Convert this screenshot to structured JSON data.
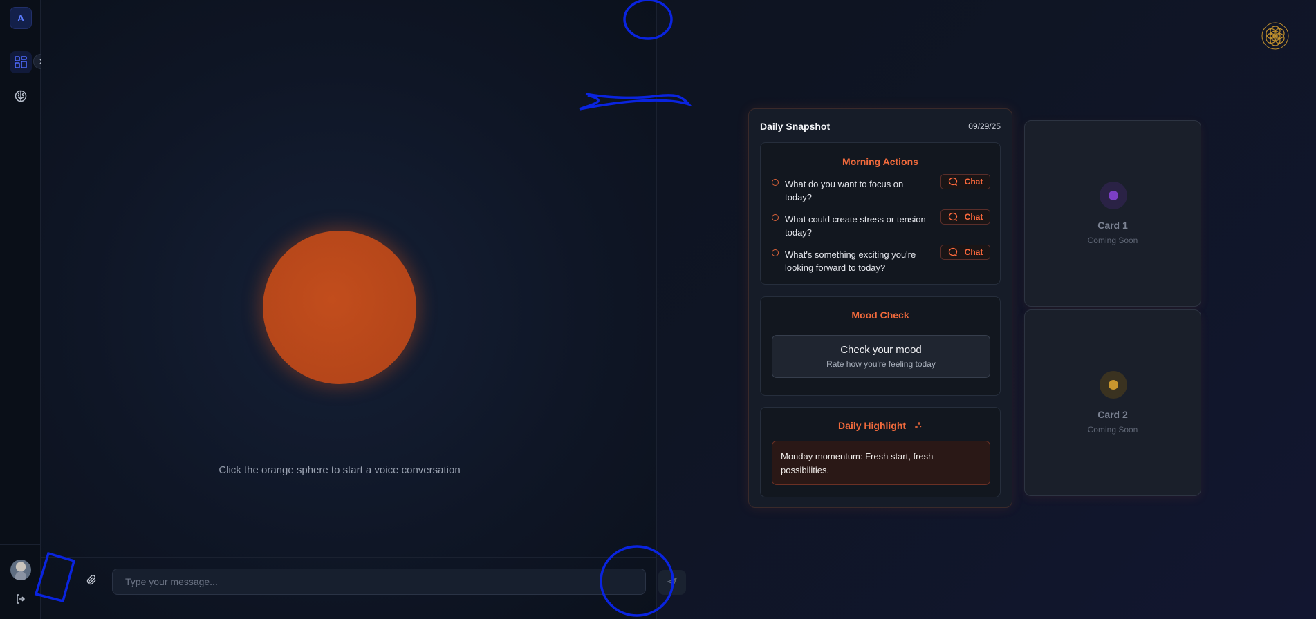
{
  "sidebar": {
    "workspace_initial": "A",
    "items": [
      {
        "icon": "dashboard-icon",
        "active": true
      },
      {
        "icon": "brain-icon",
        "active": false
      }
    ],
    "expand_icon": "chevron-right-icon",
    "logout_icon": "logout-icon"
  },
  "chat": {
    "hint": "Click the orange sphere to start a voice conversation",
    "input_placeholder": "Type your message...",
    "sphere_color": "#b5461a",
    "attach_icon": "paperclip-icon",
    "send_icon": "send-icon"
  },
  "snapshot": {
    "title": "Daily Snapshot",
    "date": "09/29/25",
    "morning_actions": {
      "title": "Morning Actions",
      "items": [
        {
          "text": "What do you want to focus on today?",
          "button": "Chat"
        },
        {
          "text": "What could create stress or tension today?",
          "button": "Chat"
        },
        {
          "text": "What's something exciting you're looking forward to today?",
          "button": "Chat"
        }
      ]
    },
    "mood_check": {
      "title": "Mood Check",
      "button_title": "Check your mood",
      "button_subtitle": "Rate how you're feeling today"
    },
    "daily_highlight": {
      "title": "Daily Highlight",
      "text": "Monday momentum: Fresh start, fresh possibilities."
    }
  },
  "cards": [
    {
      "title": "Card 1",
      "subtitle": "Coming Soon",
      "color": "#7b3fc4"
    },
    {
      "title": "Card 2",
      "subtitle": "Coming Soon",
      "color": "#c9962e"
    }
  ],
  "accent_color": "#f06a3c"
}
